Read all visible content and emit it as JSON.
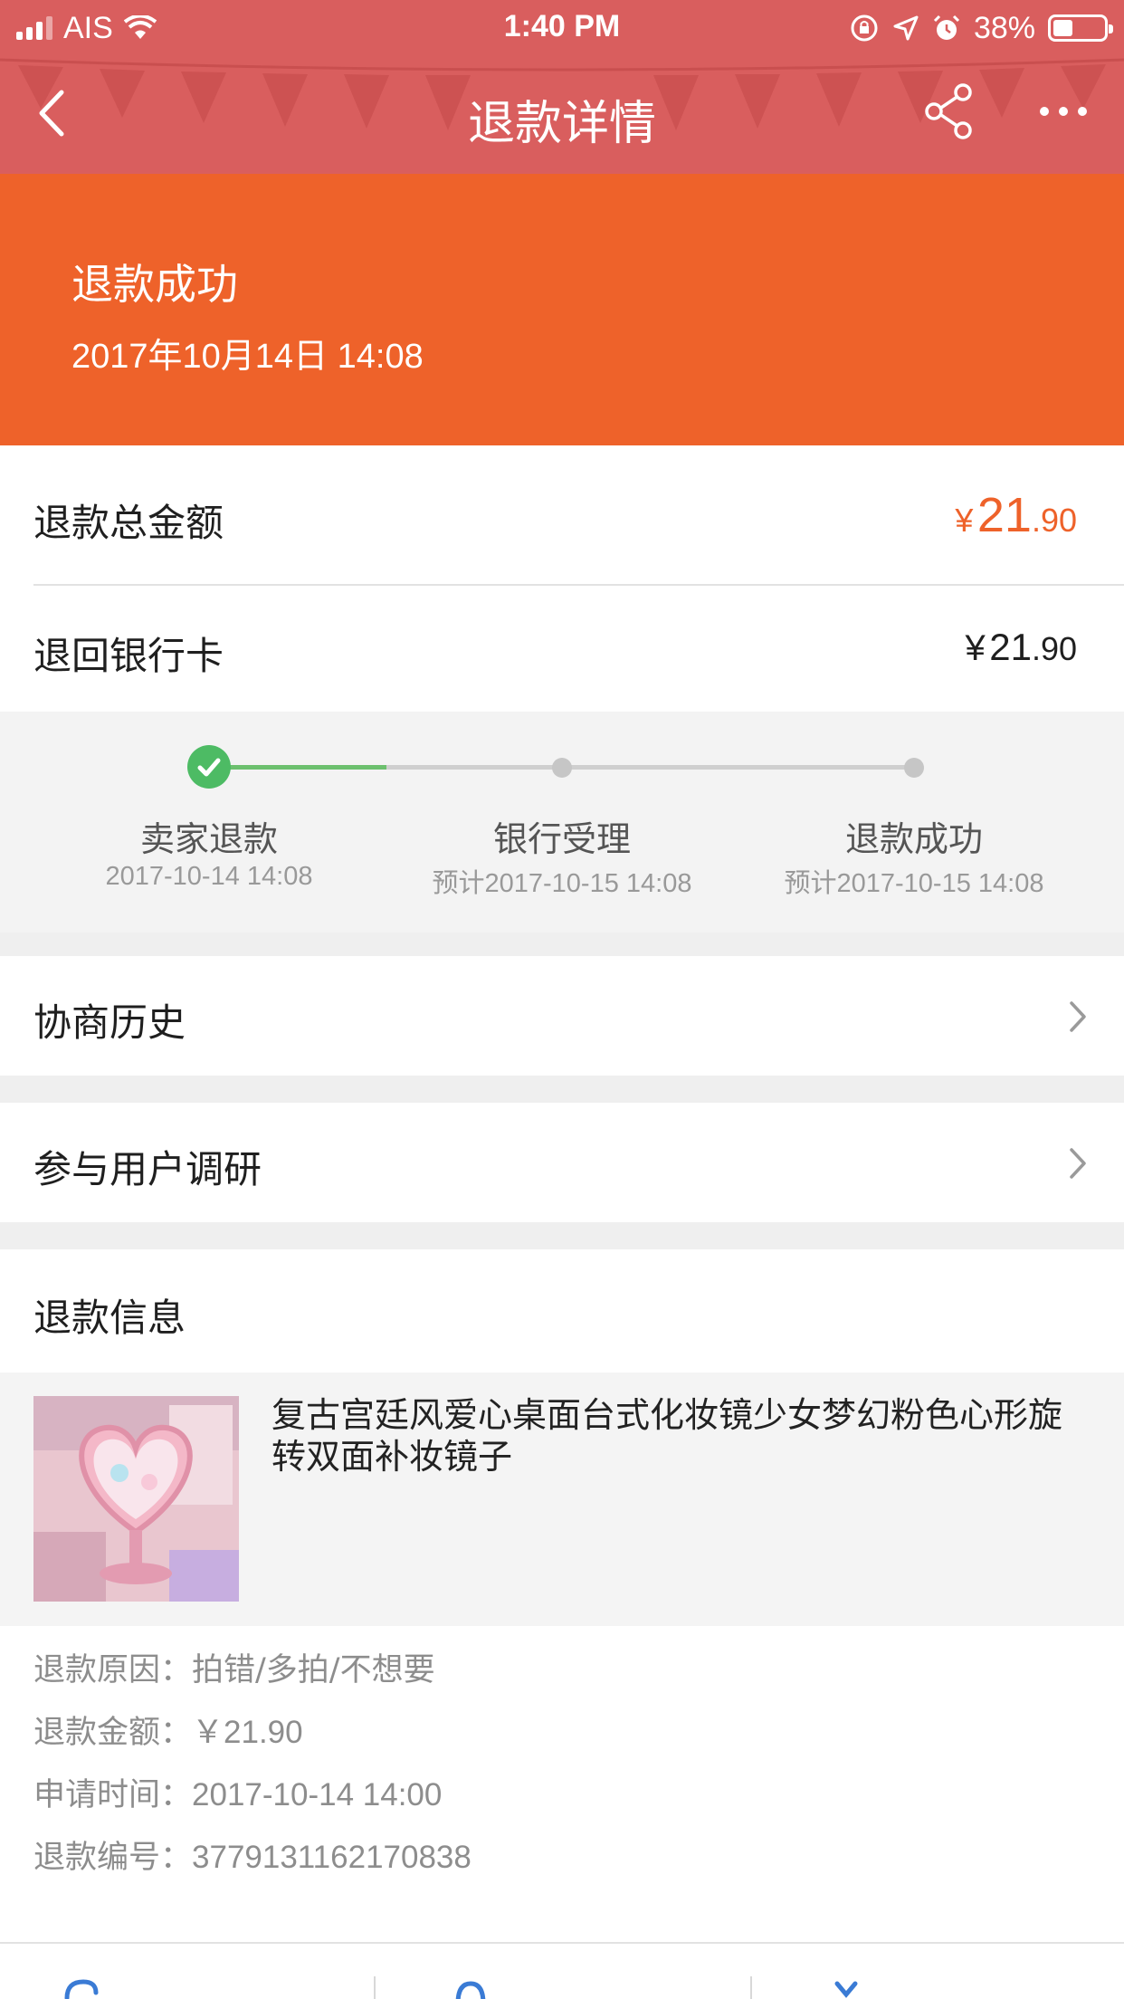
{
  "status_bar": {
    "carrier": "AIS",
    "time": "1:40 PM",
    "battery": "38%",
    "battery_level": 0.38
  },
  "nav": {
    "title": "退款详情"
  },
  "banner": {
    "status": "退款成功",
    "datetime": "2017年10月14日 14:08"
  },
  "amounts": {
    "total_label": "退款总金额",
    "total_symbol": "¥",
    "total_int": "21",
    "total_dec": ".90",
    "bank_label": "退回银行卡",
    "bank_symbol": "¥",
    "bank_int": "21",
    "bank_dec": ".90"
  },
  "progress": {
    "steps": [
      {
        "label": "卖家退款",
        "time": "2017-10-14 14:08",
        "done": true
      },
      {
        "label": "银行受理",
        "time": "预计2017-10-15 14:08",
        "done": false
      },
      {
        "label": "退款成功",
        "time": "预计2017-10-15 14:08",
        "done": false
      }
    ],
    "colors": {
      "done": "#4dbb64",
      "pending": "#c6c6c6"
    }
  },
  "links": {
    "history": "协商历史",
    "survey": "参与用户调研"
  },
  "refund_info": {
    "heading": "退款信息",
    "product_title": "复古宫廷风爱心桌面台式化妆镜少女梦幻粉色心形旋转双面补妆镜子",
    "reason_label": "退款原因：",
    "reason_value": "拍错/多拍/不想要",
    "amount_label": "退款金额：",
    "amount_value": "￥21.90",
    "time_label": "申请时间：",
    "time_value": "2017-10-14 14:00",
    "number_label": "退款编号：",
    "number_value": "3779131162170838"
  },
  "colors": {
    "header": "#d95e5e",
    "banner": "#ee622a",
    "accent": "#ee622a"
  }
}
